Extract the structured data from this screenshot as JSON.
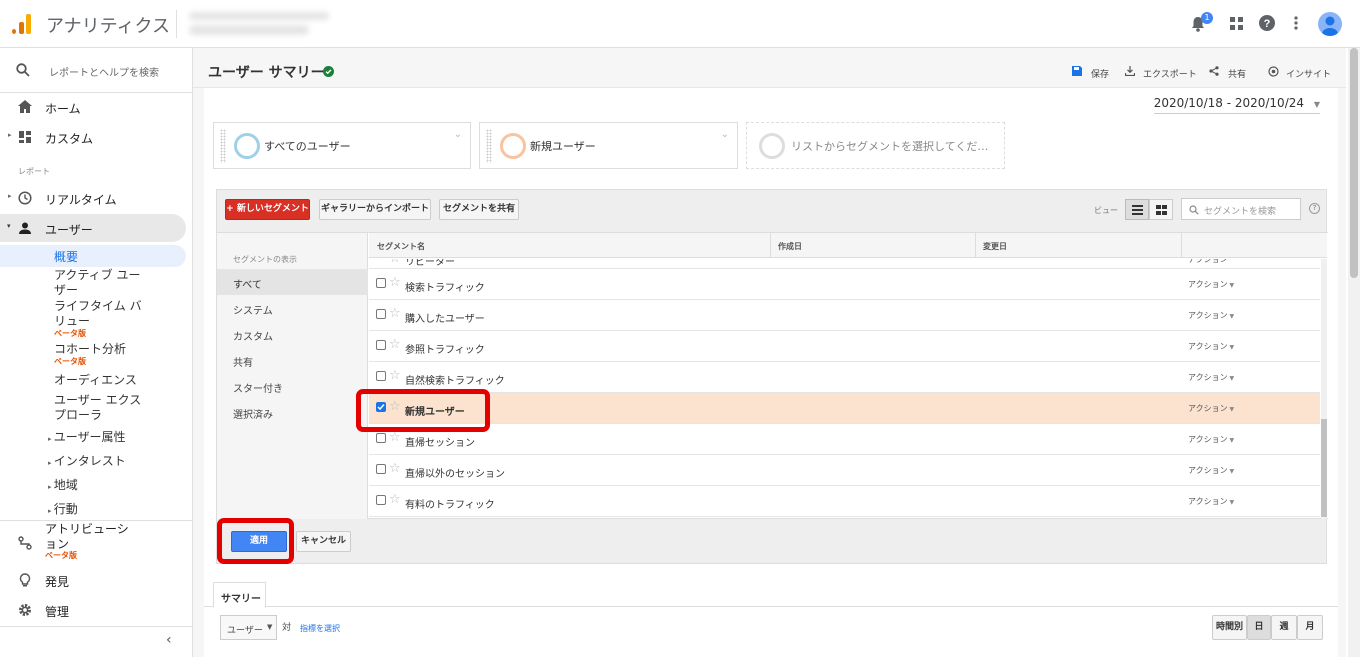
{
  "topbar": {
    "app_title": "アナリティクス",
    "notification_count": "1",
    "icons": [
      "bell-icon",
      "apps-grid-icon",
      "help-icon",
      "more-vert-icon",
      "avatar"
    ]
  },
  "sidebar": {
    "search_placeholder": "レポートとヘルプを検索",
    "home": "ホーム",
    "custom": "カスタム",
    "reports_section": "レポート",
    "realtime": "リアルタイム",
    "users": "ユーザー",
    "overview": "概要",
    "active_users": "アクティブ ユーザー",
    "lifetime_value": "ライフタイム バリュー",
    "beta": "ベータ版",
    "cohort": "コホート分析",
    "audience": "オーディエンス",
    "user_explorer": "ユーザー エクスプローラ",
    "user_attributes": "ユーザー属性",
    "interests": "インタレスト",
    "geo": "地域",
    "behavior": "行動",
    "attribution": "アトリビューション",
    "discover": "発見",
    "admin": "管理"
  },
  "header": {
    "title": "ユーザー サマリー",
    "save": "保存",
    "export": "エクスポート",
    "share": "共有",
    "insights": "インサイト"
  },
  "date_range": "2020/10/18 - 2020/10/24",
  "segments": {
    "card1": "すべてのユーザー",
    "card2": "新規ユーザー",
    "card3_placeholder": "リストからセグメントを選択してくだ…"
  },
  "segment_panel": {
    "new_segment": "+ 新しいセグメント",
    "import_gallery": "ギャラリーからインポート",
    "share_segment": "セグメントを共有",
    "view_label": "ビュー",
    "search_placeholder": "セグメントを検索",
    "side_title": "セグメントの表示",
    "side_items": [
      "すべて",
      "システム",
      "カスタム",
      "共有",
      "スター付き",
      "選択済み"
    ],
    "columns": [
      "セグメント名",
      "作成日",
      "変更日"
    ],
    "partial_row": "リピーター",
    "rows": [
      {
        "name": "検索トラフィック",
        "action": "アクション",
        "checked": false
      },
      {
        "name": "購入したユーザー",
        "action": "アクション",
        "checked": false
      },
      {
        "name": "参照トラフィック",
        "action": "アクション",
        "checked": false
      },
      {
        "name": "自然検索トラフィック",
        "action": "アクション",
        "checked": false
      },
      {
        "name": "新規ユーザー",
        "action": "アクション",
        "checked": true
      },
      {
        "name": "直帰セッション",
        "action": "アクション",
        "checked": false
      },
      {
        "name": "直帰以外のセッション",
        "action": "アクション",
        "checked": false
      },
      {
        "name": "有料のトラフィック",
        "action": "アクション",
        "checked": false
      }
    ],
    "apply": "適用",
    "cancel": "キャンセル"
  },
  "summary": {
    "tab": "サマリー",
    "metric_select": "ユーザー",
    "vs": "対",
    "select_metric": "指標を選択",
    "time_buttons": [
      "時間別",
      "日",
      "週",
      "月"
    ]
  },
  "colors": {
    "accent_blue": "#4285f4",
    "highlight_row": "#fce3cf",
    "red_annotation": "#e50000",
    "primary_red_button": "#d93025",
    "logo_orange": "#f9ab00"
  }
}
